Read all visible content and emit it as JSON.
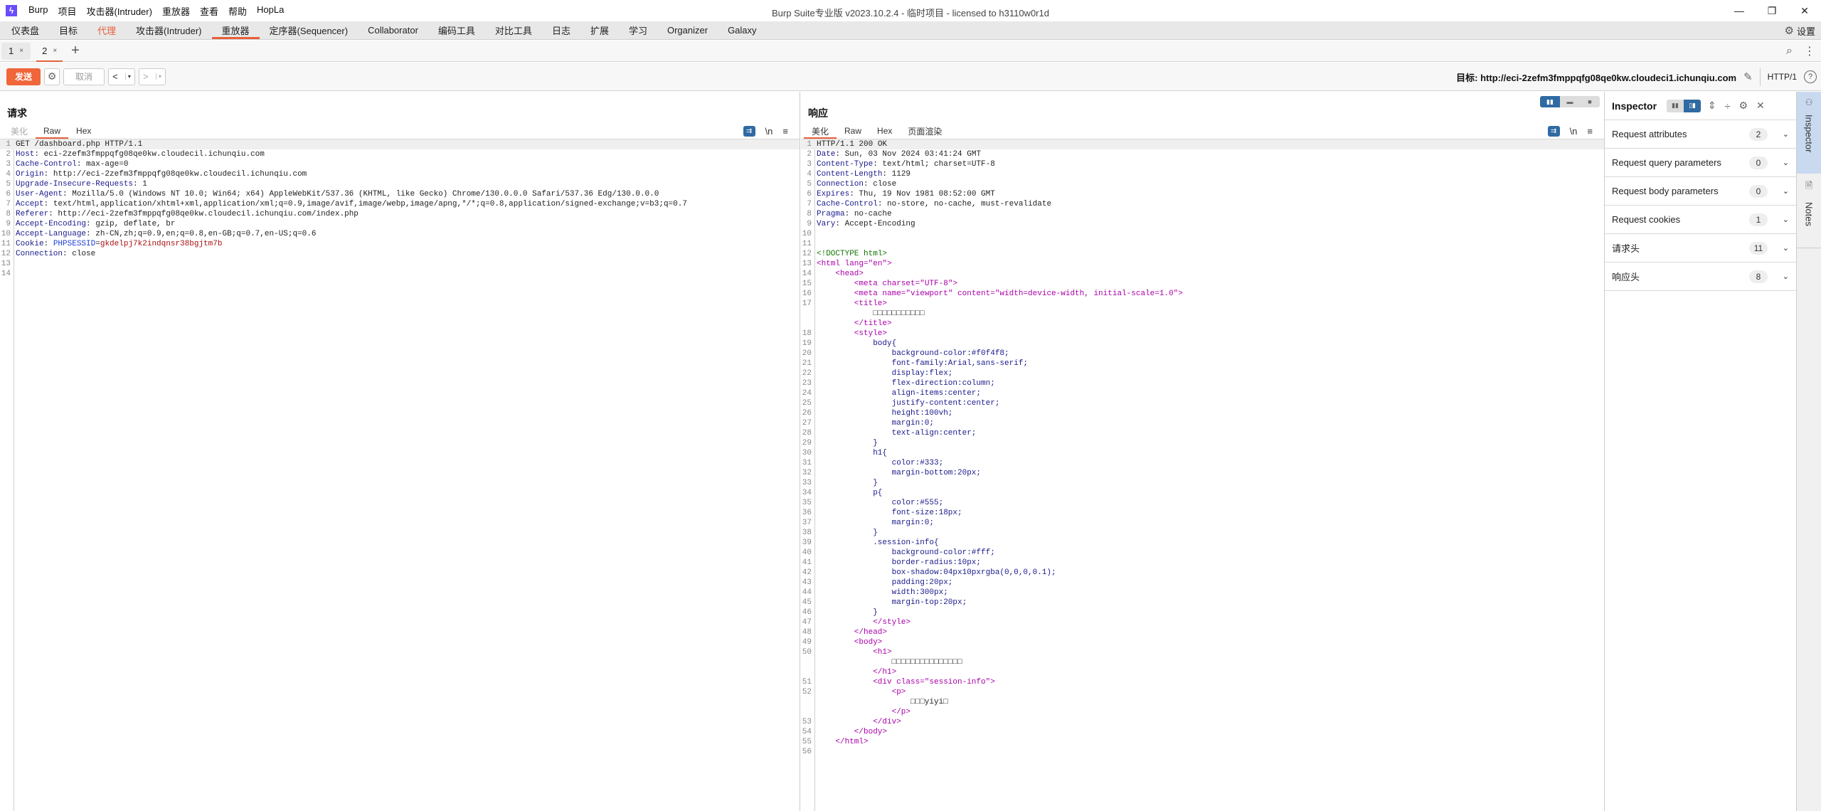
{
  "app": {
    "window_title": "Burp Suite专业版  v2023.10.2.4 - 临时项目 - licensed to h3110w0r1d",
    "logo": "burp-logo",
    "menu": [
      "Burp",
      "项目",
      "攻击器(Intruder)",
      "重放器",
      "查看",
      "帮助",
      "HopLa"
    ],
    "window_controls": {
      "minimize": "—",
      "restore": "❐",
      "close": "✕"
    }
  },
  "nav": {
    "tabs": [
      {
        "label": "仪表盘",
        "state": "normal"
      },
      {
        "label": "目标",
        "state": "normal"
      },
      {
        "label": "代理",
        "state": "orange"
      },
      {
        "label": "攻击器(Intruder)",
        "state": "normal"
      },
      {
        "label": "重放器",
        "state": "active"
      },
      {
        "label": "定序器(Sequencer)",
        "state": "normal"
      },
      {
        "label": "Collaborator",
        "state": "normal"
      },
      {
        "label": "编码工具",
        "state": "normal"
      },
      {
        "label": "对比工具",
        "state": "normal"
      },
      {
        "label": "日志",
        "state": "normal"
      },
      {
        "label": "扩展",
        "state": "normal"
      },
      {
        "label": "学习",
        "state": "normal"
      },
      {
        "label": "Organizer",
        "state": "normal"
      },
      {
        "label": "Galaxy",
        "state": "normal"
      }
    ],
    "settings_label": "设置",
    "accent_color": "#e8603c"
  },
  "repeater_tabs": {
    "tabs": [
      {
        "label": "1",
        "active": false
      },
      {
        "label": "2",
        "active": true
      }
    ],
    "close_glyph": "×",
    "add_glyph": "+"
  },
  "toolbar": {
    "send_label": "发送",
    "cancel_label": "取消",
    "prev_glyph": "<",
    "next_glyph": ">",
    "dropdown_glyph": "▾",
    "target_label": "目标: http://eci-2zefm3fmppqfg08qe0kw.cloudeci1.ichunqiu.com",
    "http_version": "HTTP/1",
    "help_glyph": "?",
    "send_color": "#f0653a"
  },
  "request": {
    "title": "请求",
    "tabs": [
      {
        "label": "美化",
        "state": "disabled"
      },
      {
        "label": "Raw",
        "state": "active"
      },
      {
        "label": "Hex",
        "state": "normal"
      }
    ],
    "tools": {
      "newline": "\\n",
      "menu": "≡"
    },
    "lines": [
      {
        "n": "1",
        "k": "",
        "v": "GET /dashboard.php HTTP/1.1"
      },
      {
        "n": "2",
        "k": "Host",
        "v": "eci-2zefm3fmppqfg08qe0kw.cloudecil.ichunqiu.com"
      },
      {
        "n": "3",
        "k": "Cache-Control",
        "v": "max-age=0"
      },
      {
        "n": "4",
        "k": "Origin",
        "v": "http://eci-2zefm3fmppqfg08qe0kw.cloudecil.ichunqiu.com"
      },
      {
        "n": "5",
        "k": "Upgrade-Insecure-Requests",
        "v": "1"
      },
      {
        "n": "6",
        "k": "User-Agent",
        "v": "Mozilla/5.0 (Windows NT 10.0; Win64; x64) AppleWebKit/537.36 (KHTML, like Gecko) Chrome/130.0.0.0 Safari/537.36 Edg/130.0.0.0"
      },
      {
        "n": "7",
        "k": "Accept",
        "v": "text/html,application/xhtml+xml,application/xml;q=0.9,image/avif,image/webp,image/apng,*/*;q=0.8,application/signed-exchange;v=b3;q=0.7"
      },
      {
        "n": "8",
        "k": "Referer",
        "v": "http://eci-2zefm3fmppqfg08qe0kw.cloudecil.ichunqiu.com/index.php"
      },
      {
        "n": "9",
        "k": "Accept-Encoding",
        "v": "gzip, deflate, br"
      },
      {
        "n": "10",
        "k": "Accept-Language",
        "v": "zh-CN,zh;q=0.9,en;q=0.8,en-GB;q=0.7,en-US;q=0.6"
      },
      {
        "n": "11",
        "k": "Cookie",
        "v": "",
        "cookie_name": "PHPSESSID",
        "cookie_value": "gkdelpj7k2indqnsr38bgjtm7b"
      },
      {
        "n": "12",
        "k": "Connection",
        "v": "close"
      },
      {
        "n": "13",
        "k": "",
        "v": ""
      },
      {
        "n": "14",
        "k": "",
        "v": ""
      }
    ]
  },
  "response": {
    "title": "响应",
    "tabs": [
      {
        "label": "美化",
        "state": "active"
      },
      {
        "label": "Raw",
        "state": "normal"
      },
      {
        "label": "Hex",
        "state": "normal"
      },
      {
        "label": "页面渲染",
        "state": "normal"
      }
    ],
    "tools": {
      "newline": "\\n",
      "menu": "≡"
    },
    "lines": [
      {
        "n": "1",
        "t": "plain",
        "s": "HTTP/1.1 200 OK"
      },
      {
        "n": "2",
        "t": "hdr",
        "k": "Date",
        "s": "Sun, 03 Nov 2024 03:41:24 GMT"
      },
      {
        "n": "3",
        "t": "hdr",
        "k": "Content-Type",
        "s": "text/html; charset=UTF-8"
      },
      {
        "n": "4",
        "t": "hdr",
        "k": "Content-Length",
        "s": "1129"
      },
      {
        "n": "5",
        "t": "hdr",
        "k": "Connection",
        "s": "close"
      },
      {
        "n": "6",
        "t": "hdr",
        "k": "Expires",
        "s": "Thu, 19 Nov 1981 08:52:00 GMT"
      },
      {
        "n": "7",
        "t": "hdr",
        "k": "Cache-Control",
        "s": "no-store, no-cache, must-revalidate"
      },
      {
        "n": "8",
        "t": "hdr",
        "k": "Pragma",
        "s": "no-cache"
      },
      {
        "n": "9",
        "t": "hdr",
        "k": "Vary",
        "s": "Accept-Encoding"
      },
      {
        "n": "10",
        "t": "plain",
        "s": ""
      },
      {
        "n": "11",
        "t": "plain",
        "s": ""
      },
      {
        "n": "12",
        "t": "doctype",
        "s": "<!DOCTYPE html>"
      },
      {
        "n": "13",
        "t": "html",
        "i": 0,
        "s": "<html lang=\"en\">"
      },
      {
        "n": "14",
        "t": "html",
        "i": 1,
        "s": "<head>"
      },
      {
        "n": "15",
        "t": "html",
        "i": 2,
        "s": "<meta charset=\"UTF-8\">"
      },
      {
        "n": "16",
        "t": "html",
        "i": 2,
        "s": "<meta name=\"viewport\" content=\"width=device-width, initial-scale=1.0\">"
      },
      {
        "n": "17",
        "t": "html",
        "i": 2,
        "s": "<title>"
      },
      {
        "n": "",
        "t": "text",
        "i": 3,
        "s": "□□□□□□□□□□□"
      },
      {
        "n": "",
        "t": "html",
        "i": 2,
        "s": "</title>"
      },
      {
        "n": "18",
        "t": "html",
        "i": 2,
        "s": "<style>"
      },
      {
        "n": "19",
        "t": "css",
        "i": 3,
        "s": "body{"
      },
      {
        "n": "20",
        "t": "css",
        "i": 4,
        "s": "background-color:#f0f4f8;"
      },
      {
        "n": "21",
        "t": "css",
        "i": 4,
        "s": "font-family:Arial,sans-serif;"
      },
      {
        "n": "22",
        "t": "css",
        "i": 4,
        "s": "display:flex;"
      },
      {
        "n": "23",
        "t": "css",
        "i": 4,
        "s": "flex-direction:column;"
      },
      {
        "n": "24",
        "t": "css",
        "i": 4,
        "s": "align-items:center;"
      },
      {
        "n": "25",
        "t": "css",
        "i": 4,
        "s": "justify-content:center;"
      },
      {
        "n": "26",
        "t": "css",
        "i": 4,
        "s": "height:100vh;"
      },
      {
        "n": "27",
        "t": "css",
        "i": 4,
        "s": "margin:0;"
      },
      {
        "n": "28",
        "t": "css",
        "i": 4,
        "s": "text-align:center;"
      },
      {
        "n": "29",
        "t": "css",
        "i": 3,
        "s": "}"
      },
      {
        "n": "30",
        "t": "css",
        "i": 3,
        "s": "h1{"
      },
      {
        "n": "31",
        "t": "css",
        "i": 4,
        "s": "color:#333;"
      },
      {
        "n": "32",
        "t": "css",
        "i": 4,
        "s": "margin-bottom:20px;"
      },
      {
        "n": "33",
        "t": "css",
        "i": 3,
        "s": "}"
      },
      {
        "n": "34",
        "t": "css",
        "i": 3,
        "s": "p{"
      },
      {
        "n": "35",
        "t": "css",
        "i": 4,
        "s": "color:#555;"
      },
      {
        "n": "36",
        "t": "css",
        "i": 4,
        "s": "font-size:18px;"
      },
      {
        "n": "37",
        "t": "css",
        "i": 4,
        "s": "margin:0;"
      },
      {
        "n": "38",
        "t": "css",
        "i": 3,
        "s": "}"
      },
      {
        "n": "39",
        "t": "css",
        "i": 3,
        "s": ".session-info{"
      },
      {
        "n": "40",
        "t": "css",
        "i": 4,
        "s": "background-color:#fff;"
      },
      {
        "n": "41",
        "t": "css",
        "i": 4,
        "s": "border-radius:10px;"
      },
      {
        "n": "42",
        "t": "css",
        "i": 4,
        "s": "box-shadow:04px10pxrgba(0,0,0,0.1);"
      },
      {
        "n": "43",
        "t": "css",
        "i": 4,
        "s": "padding:20px;"
      },
      {
        "n": "44",
        "t": "css",
        "i": 4,
        "s": "width:300px;"
      },
      {
        "n": "45",
        "t": "css",
        "i": 4,
        "s": "margin-top:20px;"
      },
      {
        "n": "46",
        "t": "css",
        "i": 3,
        "s": "}"
      },
      {
        "n": "47",
        "t": "html",
        "i": 3,
        "s": "</style>"
      },
      {
        "n": "48",
        "t": "html",
        "i": 2,
        "s": "</head>"
      },
      {
        "n": "49",
        "t": "html",
        "i": 2,
        "s": "<body>"
      },
      {
        "n": "50",
        "t": "html",
        "i": 3,
        "s": "<h1>"
      },
      {
        "n": "",
        "t": "text",
        "i": 4,
        "s": "□□□□□□□□□□□□□□□"
      },
      {
        "n": "",
        "t": "html",
        "i": 3,
        "s": "</h1>"
      },
      {
        "n": "51",
        "t": "html",
        "i": 3,
        "s": "<div class=\"session-info\">"
      },
      {
        "n": "52",
        "t": "html",
        "i": 4,
        "s": "<p>"
      },
      {
        "n": "",
        "t": "text",
        "i": 5,
        "s": "□□□yiyi□"
      },
      {
        "n": "",
        "t": "html",
        "i": 4,
        "s": "</p>"
      },
      {
        "n": "53",
        "t": "html",
        "i": 3,
        "s": "</div>"
      },
      {
        "n": "54",
        "t": "html",
        "i": 2,
        "s": "</body>"
      },
      {
        "n": "55",
        "t": "html",
        "i": 1,
        "s": "</html>"
      },
      {
        "n": "56",
        "t": "plain",
        "s": ""
      }
    ]
  },
  "inspector": {
    "title": "Inspector",
    "sections": [
      {
        "label": "Request attributes",
        "count": "2"
      },
      {
        "label": "Request query parameters",
        "count": "0"
      },
      {
        "label": "Request body parameters",
        "count": "0"
      },
      {
        "label": "Request cookies",
        "count": "1"
      },
      {
        "label": "请求头",
        "count": "11"
      },
      {
        "label": "响应头",
        "count": "8"
      }
    ],
    "chevron": "⌄",
    "close_glyph": "✕"
  },
  "right_sidebar": {
    "tabs": [
      {
        "label": "Inspector",
        "active": true
      },
      {
        "label": "Notes",
        "active": false
      }
    ]
  }
}
